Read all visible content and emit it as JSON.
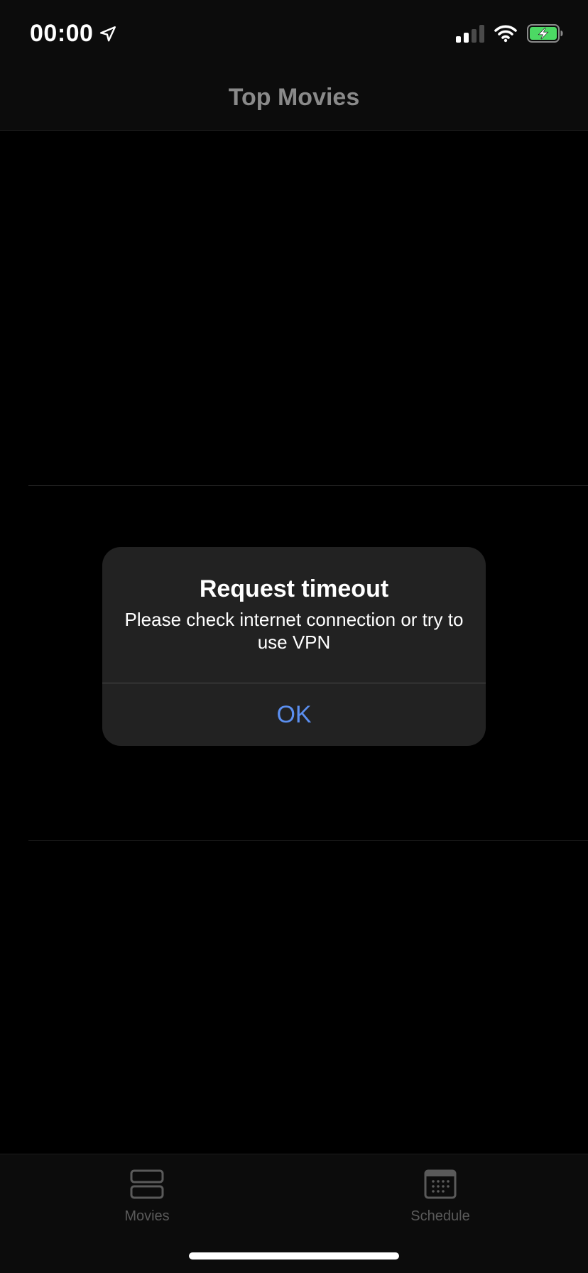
{
  "status_bar": {
    "time": "00:00",
    "icons": [
      "location-arrow-icon",
      "cellular-signal-icon",
      "wifi-icon",
      "battery-charging-icon"
    ]
  },
  "nav": {
    "title": "Top Movies"
  },
  "alert": {
    "title": "Request timeout",
    "message": "Please check internet connection or try to use VPN",
    "ok_label": "OK"
  },
  "tab_bar": {
    "items": [
      {
        "label": "Movies",
        "icon": "rows-icon"
      },
      {
        "label": "Schedule",
        "icon": "calendar-icon"
      }
    ]
  },
  "colors": {
    "accent": "#5b8ff0",
    "alert_background": "#222222",
    "battery_charge": "#4cd964",
    "background": "#000000"
  }
}
